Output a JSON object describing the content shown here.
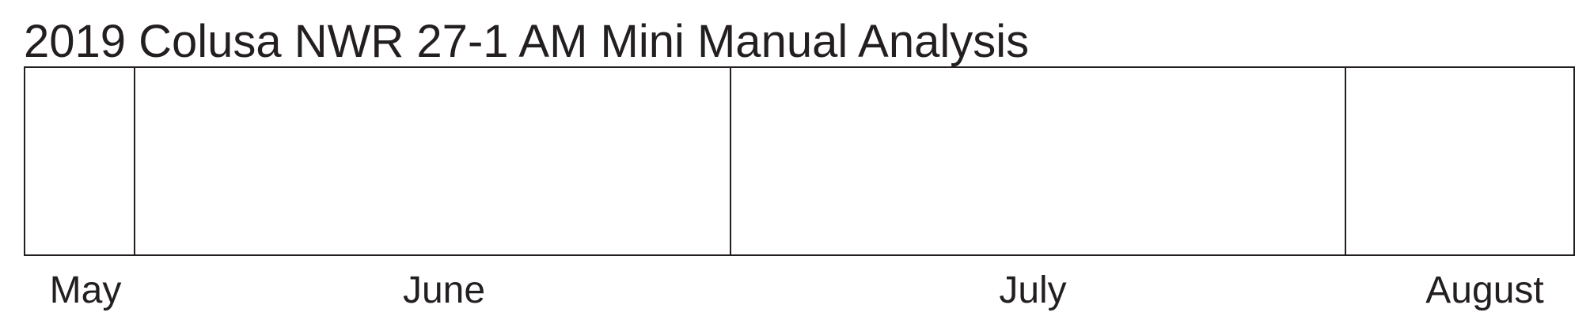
{
  "chart_data": {
    "type": "table",
    "title": "2019 Colusa NWR 27-1 AM Mini Manual Analysis",
    "months": [
      "May",
      "June",
      "July",
      "August"
    ],
    "series": []
  }
}
